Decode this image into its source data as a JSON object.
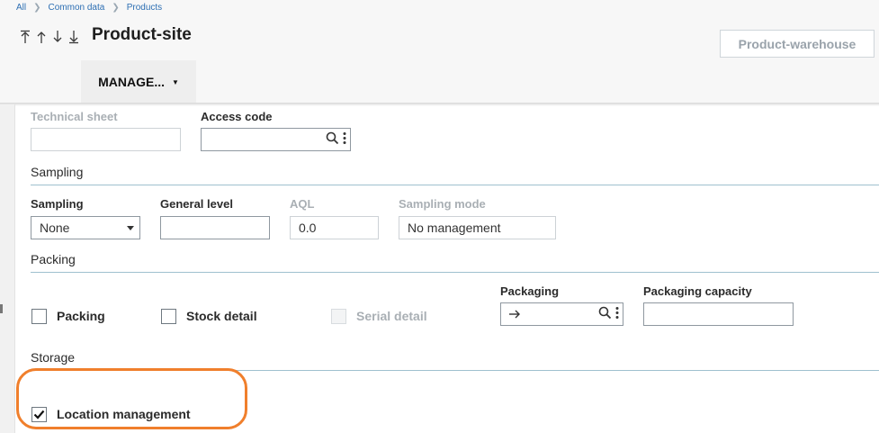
{
  "breadcrumb": [
    "All",
    "Common data",
    "Products"
  ],
  "header": {
    "title": "Product-site",
    "product_warehouse_button": "Product-warehouse",
    "manage_label": "MANAGE..."
  },
  "general": {
    "technical_sheet_label": "Technical sheet",
    "technical_sheet_value": "",
    "access_code_label": "Access code",
    "access_code_value": ""
  },
  "sampling": {
    "section_title": "Sampling",
    "sampling_label": "Sampling",
    "sampling_value": "None",
    "general_level_label": "General level",
    "general_level_value": "",
    "aql_label": "AQL",
    "aql_value": "0.0",
    "sampling_mode_label": "Sampling mode",
    "sampling_mode_value": "No management"
  },
  "packing": {
    "section_title": "Packing",
    "packing_label": "Packing",
    "packing_checked": false,
    "stock_detail_label": "Stock detail",
    "stock_detail_checked": false,
    "serial_detail_label": "Serial detail",
    "serial_detail_checked": false,
    "packaging_label": "Packaging",
    "packaging_value": "",
    "packaging_capacity_label": "Packaging capacity",
    "packaging_capacity_value": ""
  },
  "storage": {
    "section_title": "Storage",
    "location_management_label": "Location management",
    "location_management_checked": true
  },
  "colors": {
    "accent_rule": "#9fc0cf",
    "highlight": "#f07f2c",
    "link": "#2d6fb3"
  }
}
